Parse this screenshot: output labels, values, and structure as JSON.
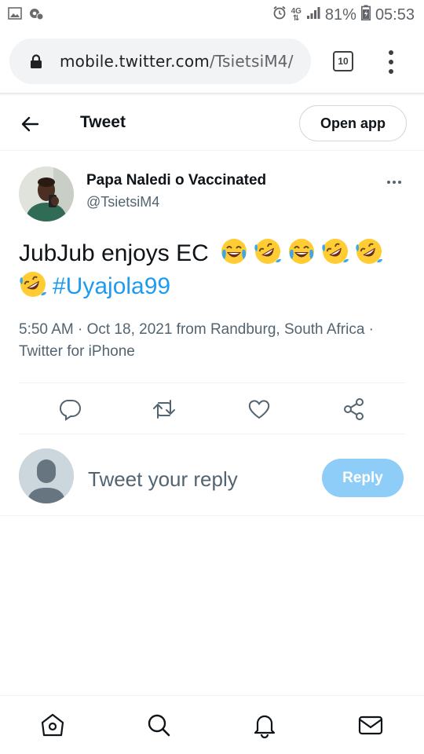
{
  "status_bar": {
    "network": "4G",
    "battery": "81%",
    "time": "05:53",
    "icons": [
      "gallery-icon",
      "settings-notification-icon",
      "alarm-icon",
      "signal-icon",
      "battery-icon"
    ]
  },
  "browser": {
    "url_domain": "mobile.twitter.com",
    "url_path": "/TsietsiM4/",
    "tab_count": "10"
  },
  "header": {
    "title": "Tweet",
    "open_app_label": "Open app"
  },
  "tweet": {
    "author_name": "Papa Naledi o Vaccinated",
    "author_handle": "@TsietsiM4",
    "text": "JubJub enjoys EC",
    "emojis": [
      "face-with-tears-of-joy",
      "rolling-on-the-floor-laughing",
      "face-with-tears-of-joy",
      "rolling-on-the-floor-laughing",
      "rolling-on-the-floor-laughing",
      "rolling-on-the-floor-laughing"
    ],
    "hashtag": "#Uyajola99",
    "meta": "5:50 AM · Oct 18, 2021 from Randburg, South Africa · Twitter for iPhone"
  },
  "actions": [
    "reply-icon",
    "retweet-icon",
    "like-icon",
    "share-icon"
  ],
  "reply": {
    "placeholder": "Tweet your reply",
    "button_label": "Reply"
  },
  "bottom_nav": [
    "home-icon",
    "search-icon",
    "notifications-icon",
    "messages-icon"
  ],
  "colors": {
    "accent": "#1d9bf0",
    "reply_button_disabled": "#8ecdf8",
    "text_primary": "#0f1419",
    "text_secondary": "#536471"
  }
}
